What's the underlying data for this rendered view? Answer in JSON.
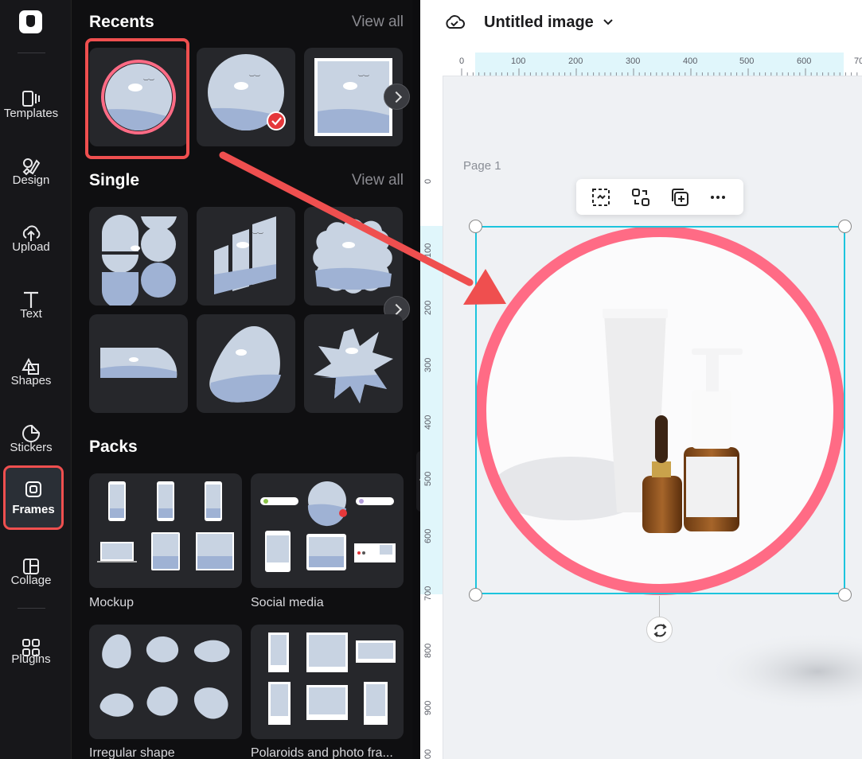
{
  "rail": {
    "items": [
      {
        "label": "Templates",
        "icon": "templates-icon"
      },
      {
        "label": "Design",
        "icon": "design-icon"
      },
      {
        "label": "Upload",
        "icon": "upload-icon"
      },
      {
        "label": "Text",
        "icon": "text-icon"
      },
      {
        "label": "Shapes",
        "icon": "shapes-icon"
      },
      {
        "label": "Stickers",
        "icon": "stickers-icon"
      },
      {
        "label": "Frames",
        "icon": "frames-icon",
        "active": true
      },
      {
        "label": "Collage",
        "icon": "collage-icon"
      },
      {
        "label": "Plugins",
        "icon": "plugins-icon"
      }
    ]
  },
  "panel": {
    "recents": {
      "title": "Recents",
      "view_all": "View all"
    },
    "single": {
      "title": "Single",
      "view_all": "View all"
    },
    "packs": {
      "title": "Packs",
      "items": [
        "Mockup",
        "Social media",
        "Irregular shape",
        "Polaroids and photo fra..."
      ]
    }
  },
  "editor": {
    "title": "Untitled image",
    "page_label": "Page 1",
    "ruler_h": [
      "0",
      "100",
      "200",
      "300",
      "400",
      "500",
      "600",
      "70"
    ],
    "ruler_v": [
      "0",
      "100",
      "200",
      "300",
      "400",
      "500",
      "600",
      "700",
      "800",
      "900",
      "00"
    ]
  },
  "colors": {
    "accent_red": "#ef4f4f",
    "frame_ring": "#ff6b85",
    "selection": "#1cc4dd"
  }
}
